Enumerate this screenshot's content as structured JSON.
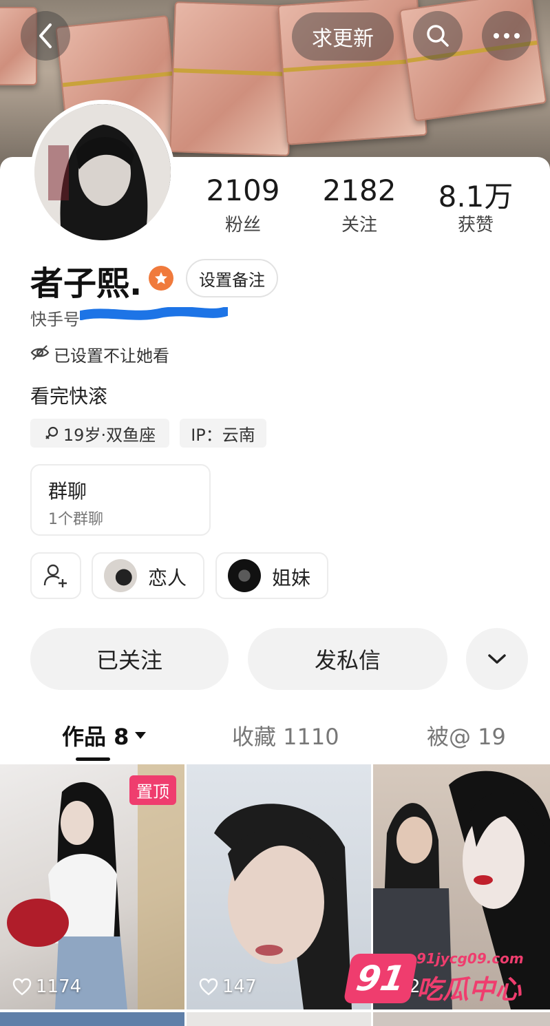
{
  "header": {
    "request_update_label": "求更新"
  },
  "profile": {
    "name": "者子熙.",
    "remark_button": "设置备注",
    "kuaishou_id_label": "快手号",
    "hidden_notice": "已设置不让她看",
    "bio": "看完快滚",
    "tags": [
      "19岁·双鱼座",
      "IP：云南"
    ],
    "stats": [
      {
        "value": "2109",
        "label": "粉丝"
      },
      {
        "value": "2182",
        "label": "关注"
      },
      {
        "value": "8.1万",
        "label": "获赞"
      }
    ]
  },
  "group_chat": {
    "title": "群聊",
    "subtitle": "1个群聊"
  },
  "relations": [
    {
      "label": "恋人"
    },
    {
      "label": "姐妹"
    }
  ],
  "actions": {
    "follow_label": "已关注",
    "message_label": "发私信"
  },
  "tabs": [
    {
      "label": "作品 8"
    },
    {
      "label": "收藏 1110"
    },
    {
      "label": "被@ 19"
    }
  ],
  "videos": [
    {
      "likes": "1174",
      "pinned_label": "置顶"
    },
    {
      "likes": "147"
    },
    {
      "likes": "2"
    }
  ],
  "watermark": {
    "number": "91",
    "domain": "91jycg09.com",
    "site_name": "吃瓜中心"
  },
  "colors": {
    "accent_pink": "#ef3d6e",
    "verified_orange": "#f07a3c"
  }
}
